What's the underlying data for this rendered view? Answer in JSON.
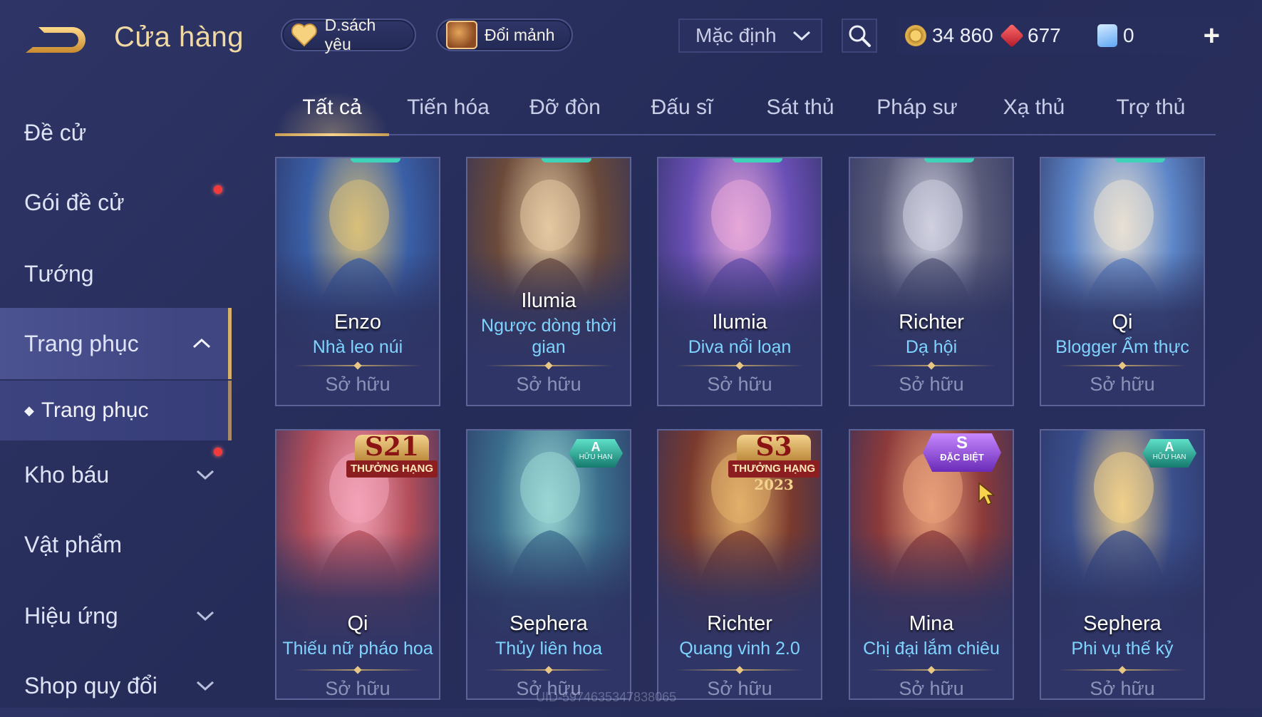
{
  "header": {
    "title": "Cửa hàng",
    "favorites_label": "D.sách yêu",
    "exchange_label": "Đổi mảnh",
    "sort_value": "Mặc định",
    "currencies": {
      "gold": "34 860",
      "rubies": "677",
      "vouchers": "0"
    }
  },
  "sidebar": {
    "items": [
      {
        "label": "Đề cử"
      },
      {
        "label": "Gói đề cử"
      },
      {
        "label": "Tướng"
      },
      {
        "label": "Trang phục"
      },
      {
        "label": "Trang phục"
      },
      {
        "label": "Kho báu"
      },
      {
        "label": "Vật phẩm"
      },
      {
        "label": "Hiệu ứng"
      },
      {
        "label": "Shop quy đổi"
      }
    ]
  },
  "tabs": [
    "Tất cả",
    "Tiến hóa",
    "Đỡ đòn",
    "Đấu sĩ",
    "Sát thủ",
    "Pháp sư",
    "Xạ thủ",
    "Trợ thủ"
  ],
  "cards": [
    {
      "hero": "Enzo",
      "skin": "Nhà leo núi",
      "status": "Sở hữu",
      "color1": "#3a5fa6",
      "color2": "#d9c07a"
    },
    {
      "hero": "Ilumia",
      "skin": "Ngược dòng thời gian",
      "status": "Sở hữu",
      "color1": "#6b4a3a",
      "color2": "#e3c9a2"
    },
    {
      "hero": "Ilumia",
      "skin": "Diva nổi loạn",
      "status": "Sở hữu",
      "color1": "#6a4fb5",
      "color2": "#e7a8d8"
    },
    {
      "hero": "Richter",
      "skin": "Dạ hội",
      "status": "Sở hữu",
      "color1": "#5a5c7a",
      "color2": "#cfd0e0"
    },
    {
      "hero": "Qi",
      "skin": "Blogger Ẩm thực",
      "status": "Sở hữu",
      "color1": "#5d86c8",
      "color2": "#e8e0d4"
    },
    {
      "hero": "Qi",
      "skin": "Thiếu nữ pháo hoa",
      "status": "Sở hữu",
      "color1": "#b34e5a",
      "color2": "#f3a3b8",
      "badge": {
        "type": "rank",
        "big": "S21",
        "label": "THƯỞNG HẠNG",
        "year": ""
      }
    },
    {
      "hero": "Sephera",
      "skin": "Thủy liên hoa",
      "status": "Sở hữu",
      "color1": "#3b6f8d",
      "color2": "#9ad7d4",
      "badge": {
        "type": "a",
        "big": "A",
        "label": "HỮU HẠN"
      }
    },
    {
      "hero": "Richter",
      "skin": "Quang vinh 2.0",
      "status": "Sở hữu",
      "color1": "#7a3a2e",
      "color2": "#e2b06a",
      "badge": {
        "type": "rank",
        "big": "S3",
        "label": "THƯỞNG HẠNG",
        "year": "2023"
      }
    },
    {
      "hero": "Mina",
      "skin": "Chị đại lắm chiêu",
      "status": "Sở hữu",
      "color1": "#8c3a3a",
      "color2": "#e8a17a",
      "badge": {
        "type": "s",
        "big": "S",
        "label": "ĐẶC BIỆT"
      }
    },
    {
      "hero": "Sephera",
      "skin": "Phi vụ thế kỷ",
      "status": "Sở hữu",
      "color1": "#3a4f8d",
      "color2": "#f0d08a",
      "badge": {
        "type": "a",
        "big": "A",
        "label": "HỮU HẠN"
      }
    }
  ],
  "watermark": "UID-5974635347838065",
  "colors": {
    "accent_gold": "#d7b06a",
    "skin_name": "#7fd4ff",
    "background": "#2b315f"
  }
}
